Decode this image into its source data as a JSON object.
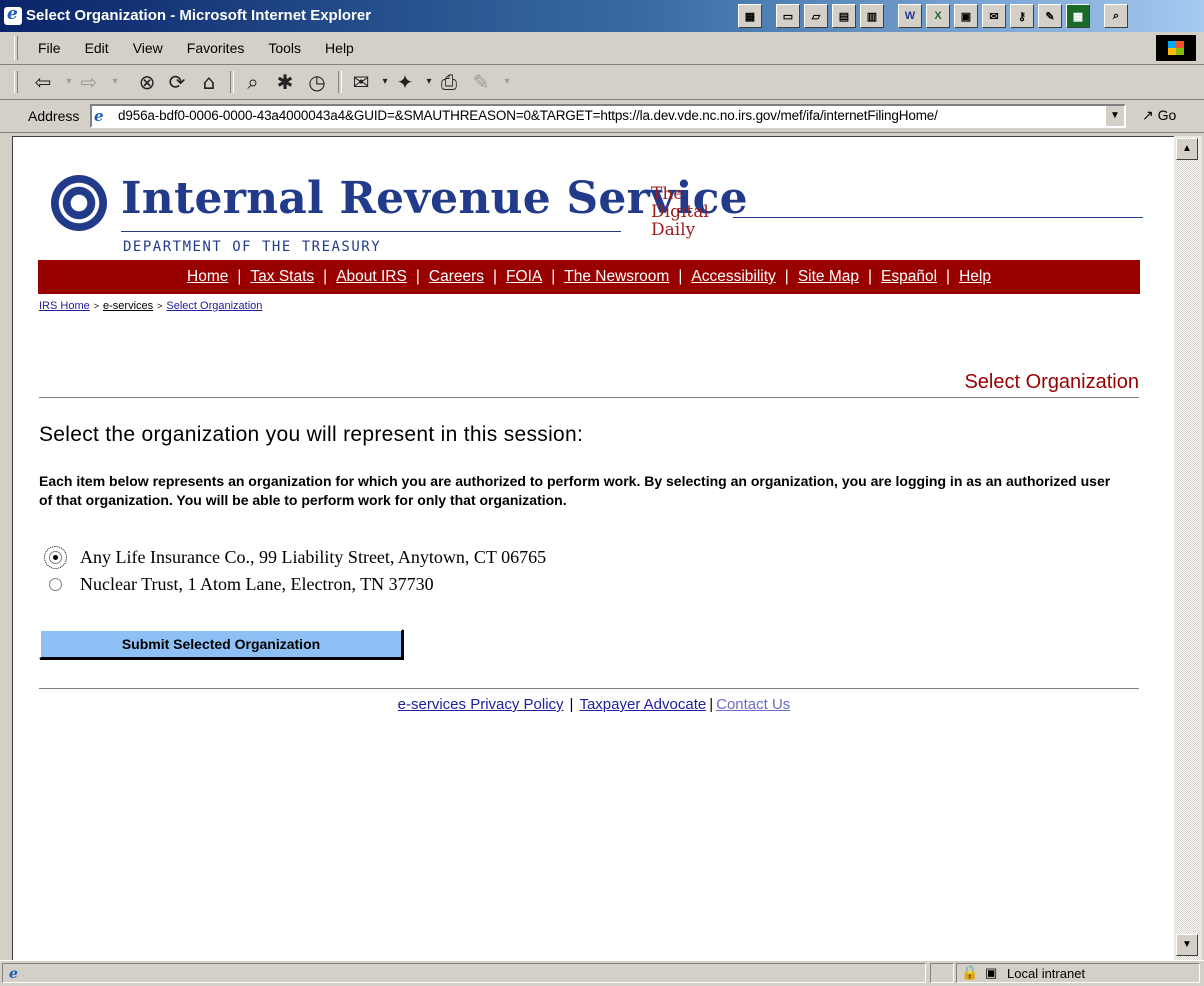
{
  "window": {
    "title": "Select Organization - Microsoft Internet Explorer"
  },
  "menu": [
    "File",
    "Edit",
    "View",
    "Favorites",
    "Tools",
    "Help"
  ],
  "toolbar": {
    "buttons": [
      "back-icon",
      "forward-icon",
      "stop-icon",
      "refresh-icon",
      "home-icon",
      "search-icon",
      "favorites-icon",
      "history-icon",
      "mail-icon",
      "print-icon",
      "edit-icon"
    ]
  },
  "address": {
    "label": "Address",
    "url": "d956a-bdf0-0006-0000-43a4000043a4&GUID=&SMAUTHREASON=0&TARGET=https://la.dev.vde.nc.no.irs.gov/mef/ifa/internetFilingHome/",
    "go": "Go"
  },
  "logo": {
    "title": "Internal Revenue Service",
    "subtitle": "DEPARTMENT OF THE TREASURY",
    "tagline": [
      "The",
      "Digital",
      "Daily"
    ]
  },
  "nav": [
    "Home",
    "Tax Stats",
    "About IRS",
    "Careers",
    "FOIA",
    "The Newsroom",
    "Accessibility",
    "Site Map",
    "Español",
    "Help"
  ],
  "breadcrumb": [
    "IRS Home",
    "e-services",
    "Select Organization"
  ],
  "page": {
    "section_title": "Select Organization",
    "heading": "Select the organization you will represent in this session:",
    "description": "Each item below represents an organization for which you are authorized to perform work. By selecting an organization, you are logging in as an authorized user of that organization. You will be able to perform work for only that organization.",
    "options": [
      {
        "label": "Any Life Insurance Co., 99 Liability Street, Anytown, CT 06765",
        "selected": true
      },
      {
        "label": "Nuclear Trust, 1 Atom Lane, Electron, TN 37730",
        "selected": false
      }
    ],
    "submit_label": "Submit Selected Organization"
  },
  "footer": {
    "links": [
      "e-services Privacy Policy",
      "Taxpayer Advocate",
      "Contact Us"
    ]
  },
  "status": {
    "zone": "Local intranet"
  },
  "colors": {
    "nav_bg": "#990000",
    "irs_blue": "#223a8a",
    "button": "#8fc0f5"
  }
}
